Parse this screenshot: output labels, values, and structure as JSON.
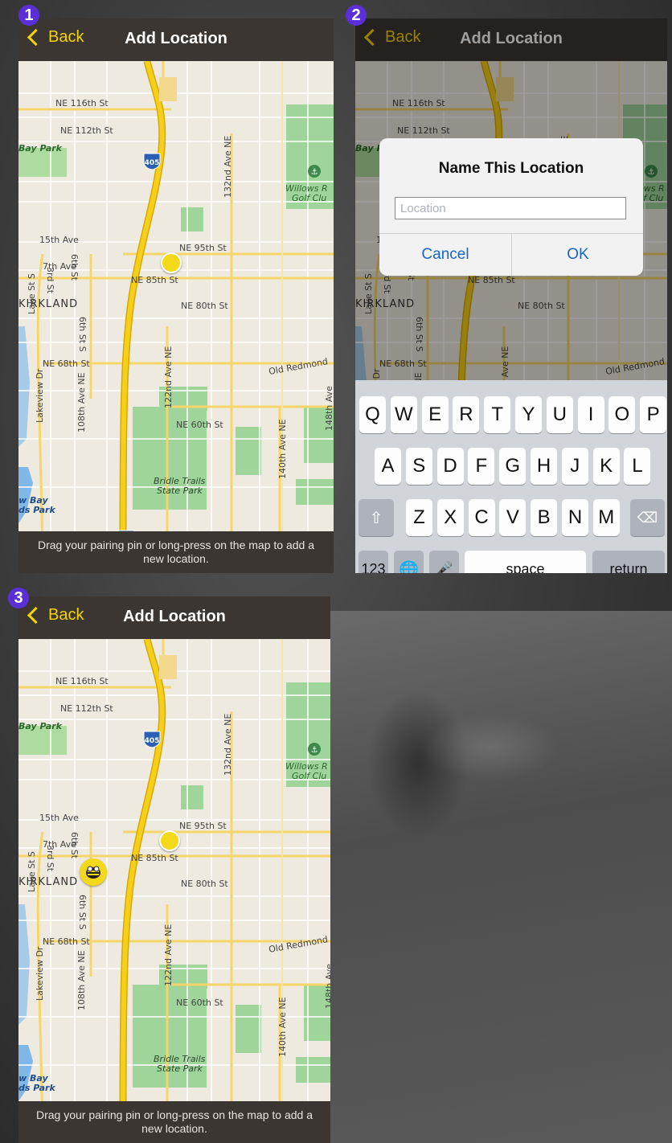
{
  "screens": [
    {
      "step": "1",
      "nav": {
        "back_label": "Back",
        "title": "Add Location"
      },
      "footer": "Drag your pairing pin or long-press on the map to add a new location."
    },
    {
      "step": "2",
      "nav": {
        "back_label": "Back",
        "title": "Add Location"
      },
      "dialog": {
        "title": "Name This Location",
        "input_placeholder": "Location",
        "cancel_label": "Cancel",
        "ok_label": "OK"
      },
      "keyboard": {
        "row1": [
          "Q",
          "W",
          "E",
          "R",
          "T",
          "Y",
          "U",
          "I",
          "O",
          "P"
        ],
        "row2": [
          "A",
          "S",
          "D",
          "F",
          "G",
          "H",
          "J",
          "K",
          "L"
        ],
        "row3": [
          "Z",
          "X",
          "C",
          "V",
          "B",
          "N",
          "M"
        ],
        "numbers_label": "123",
        "space_label": "space",
        "return_label": "return"
      }
    },
    {
      "step": "3",
      "nav": {
        "back_label": "Back",
        "title": "Add Location"
      },
      "footer": "Drag your pairing pin or long-press on the map to add a new location."
    }
  ],
  "map": {
    "labels": [
      "NE 116th St",
      "NE 112th St",
      "Bay Park",
      "405",
      "132nd Ave NE",
      "Willows R",
      "Golf Clu",
      "15th Ave",
      "3rd St",
      "6th St",
      "NE 95th St",
      "7th Ave",
      "NE 85th St",
      "KIRKLAND",
      "NE 80th St",
      "Lake St S",
      "6th St S",
      "NE 68th St",
      "Old Redmond",
      "122nd Ave NE",
      "Lakeview Dr",
      "108th Ave NE",
      "NE 60th St",
      "140th Ave NE",
      "148th Ave",
      "Bridle Trails",
      "State Park",
      "w Bay",
      "ds Park",
      "NE"
    ]
  },
  "colors": {
    "accent": "#f4d400",
    "navbar": "#3b3631",
    "badge": "#5b2fd8",
    "link_blue": "#1a64c8",
    "park_green": "#9fd49a",
    "highway": "#f5c400"
  }
}
